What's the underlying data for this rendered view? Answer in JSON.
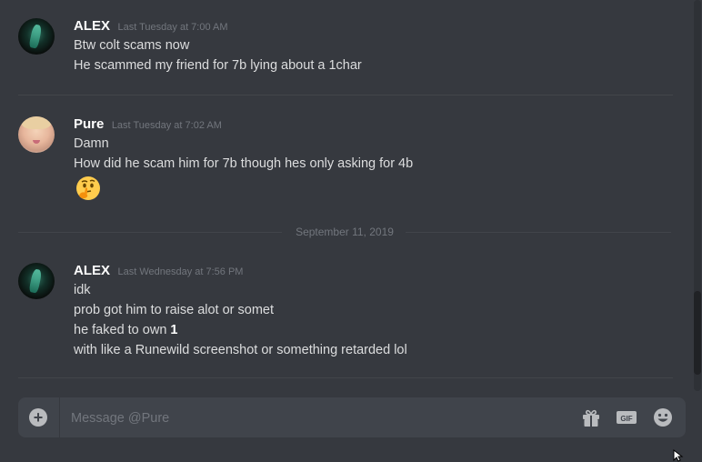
{
  "messages": [
    {
      "username": "ALEX",
      "timestamp": "Last Tuesday at 7:00 AM",
      "lines": [
        "Btw colt scams now",
        "He scammed my friend for 7b lying about a 1char"
      ]
    },
    {
      "username": "Pure",
      "timestamp": "Last Tuesday at 7:02 AM",
      "lines": [
        "Damn",
        "How did he scam him for 7b though hes only asking for 4b"
      ],
      "emoji": "thinking-face"
    },
    {
      "username": "ALEX",
      "timestamp": "Last Wednesday at 7:56 PM",
      "lines": [
        "idk",
        "prob got him to raise alot or somet",
        "he faked to own ",
        "with like a Runewild screenshot or something retarded lol"
      ],
      "bold_fragment": "1"
    }
  ],
  "date_divider": "September 11, 2019",
  "composer": {
    "placeholder": "Message @Pure"
  },
  "icons": {
    "attach": "plus-circle-icon",
    "gift": "gift-icon",
    "gif": "gif-icon",
    "emoji": "smile-icon"
  },
  "colors": {
    "background": "#36393f",
    "input_background": "#40444b",
    "username": "#ffffff",
    "text": "#dcddde",
    "muted": "#72767d"
  }
}
